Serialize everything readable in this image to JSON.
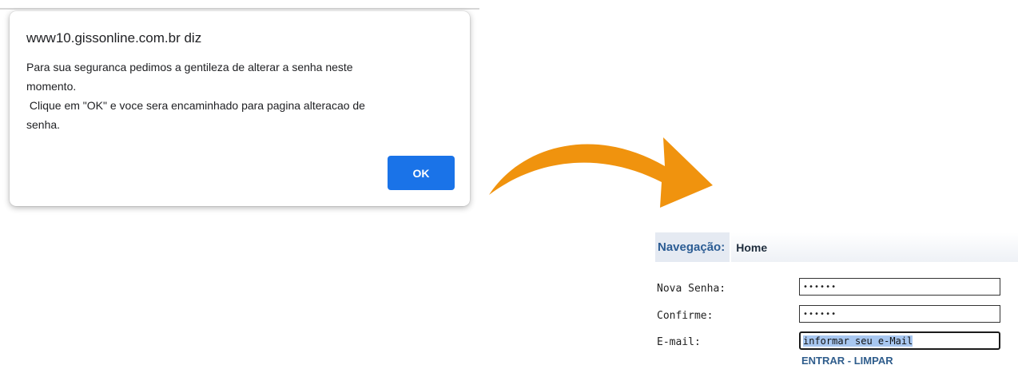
{
  "dialog": {
    "title": "www10.gissonline.com.br diz",
    "message_lines": [
      "Para sua seguranca pedimos a gentileza de alterar a senha neste",
      "momento.",
      " Clique em \"OK\" e voce sera encaminhado para pagina alteracao de",
      "senha."
    ],
    "ok_label": "OK"
  },
  "arrow": {
    "color": "#f0930e",
    "icon": "curved-arrow-right"
  },
  "navigation": {
    "label": "Navegação:",
    "home": "Home"
  },
  "form": {
    "new_password_label": "Nova Senha:",
    "new_password_value": "••••••",
    "confirm_label": "Confirme:",
    "confirm_value": "••••••",
    "email_label": "E-mail:",
    "email_value": "informar seu e-Mail",
    "enter_label": "ENTRAR",
    "separator": " - ",
    "clear_label": "LIMPAR"
  }
}
